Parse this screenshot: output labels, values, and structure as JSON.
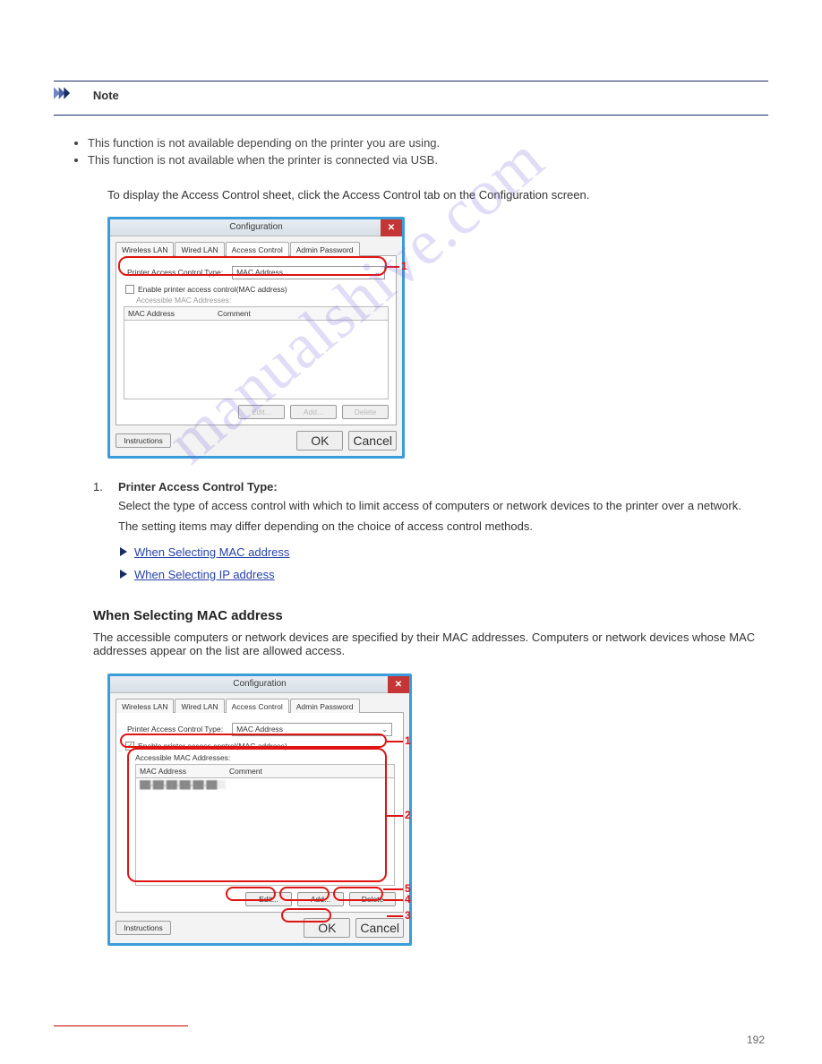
{
  "watermark": "manualshive.com",
  "note": {
    "label": "Note",
    "items": [
      "This function is not available depending on the printer you are using.",
      "This function is not available when the printer is connected via USB."
    ]
  },
  "intro": "To display the Access Control sheet, click the Access Control tab on the Configuration screen.",
  "screenshots": {
    "first": {
      "title": "Configuration",
      "tabs": [
        "Wireless LAN",
        "Wired LAN",
        "Access Control",
        "Admin Password"
      ],
      "activeTab": "Access Control",
      "typeLabel": "Printer Access Control Type:",
      "typeValue": "MAC Address",
      "enableLabel": "Enable printer access control(MAC address)",
      "checked": false,
      "subLabel": "Accessible MAC Addresses:",
      "cols": [
        "MAC Address",
        "Comment"
      ],
      "buttons": {
        "edit": "Edit...",
        "add": "Add...",
        "del": "Delete",
        "ok": "OK",
        "cancel": "Cancel",
        "instr": "Instructions"
      },
      "annot": "1"
    },
    "second": {
      "title": "Configuration",
      "tabs": [
        "Wireless LAN",
        "Wired LAN",
        "Access Control",
        "Admin Password"
      ],
      "activeTab": "Access Control",
      "typeLabel": "Printer Access Control Type:",
      "typeValue": "MAC Address",
      "enableLabel": "Enable printer access control(MAC address)",
      "checked": true,
      "subLabel": "Accessible MAC Addresses:",
      "cols": [
        "MAC Address",
        "Comment"
      ],
      "rowSample": "██-██-██-██-██-██",
      "buttons": {
        "edit": "Edit...",
        "add": "Add...",
        "del": "Delete",
        "ok": "OK",
        "cancel": "Cancel",
        "instr": "Instructions"
      },
      "annots": [
        "1",
        "2",
        "3",
        "4",
        "5"
      ]
    }
  },
  "typeItem": {
    "num": "1.",
    "title": "Printer Access Control Type:",
    "desc": "Select the type of access control with which to limit access of computers or network devices to the printer over a network.",
    "desc2": "The setting items may differ depending on the choice of access control methods."
  },
  "links": {
    "mac": "When Selecting MAC address",
    "ip": "When Selecting IP address"
  },
  "macSection": {
    "head": "When Selecting MAC address",
    "sub": "The accessible computers or network devices are specified by their MAC addresses. Computers or network devices whose MAC addresses appear on the list are allowed access."
  },
  "pageNumber": "192"
}
